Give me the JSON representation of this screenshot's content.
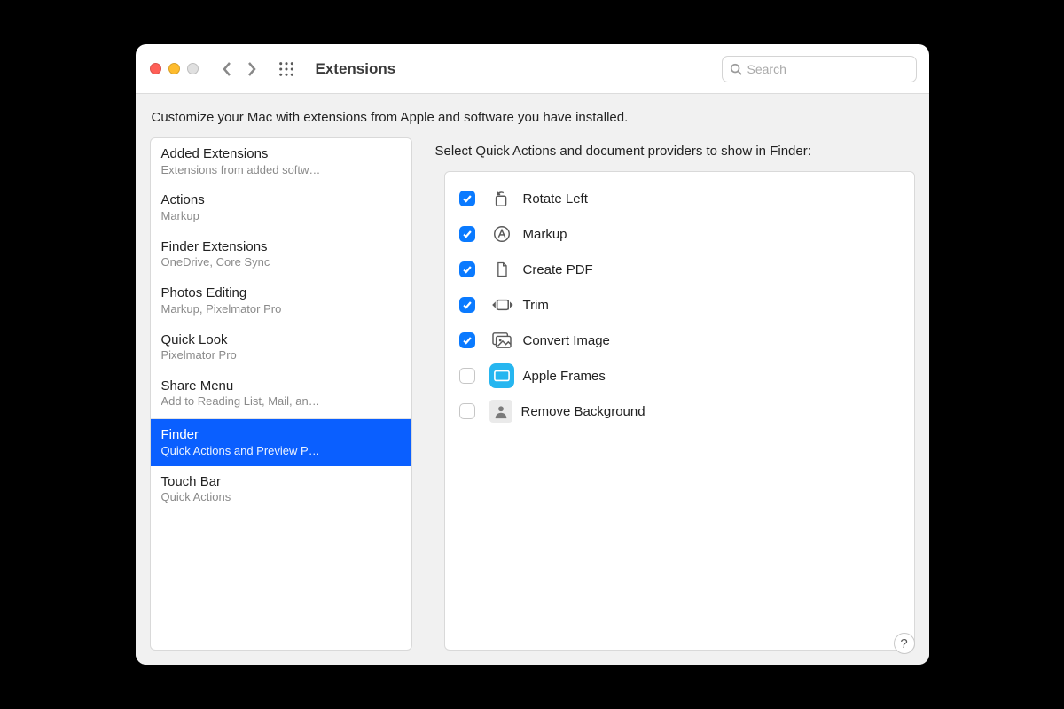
{
  "window": {
    "title": "Extensions",
    "search_placeholder": "Search"
  },
  "intro": "Customize your Mac with extensions from Apple and software you have installed.",
  "sidebar": {
    "items": [
      {
        "title": "Added Extensions",
        "sub": "Extensions from added softw…",
        "selected": false
      },
      {
        "title": "Actions",
        "sub": "Markup",
        "selected": false
      },
      {
        "title": "Finder Extensions",
        "sub": "OneDrive, Core Sync",
        "selected": false
      },
      {
        "title": "Photos Editing",
        "sub": "Markup, Pixelmator Pro",
        "selected": false
      },
      {
        "title": "Quick Look",
        "sub": "Pixelmator Pro",
        "selected": false
      },
      {
        "title": "Share Menu",
        "sub": "Add to Reading List, Mail, an…",
        "selected": false
      },
      {
        "title": "Finder",
        "sub": "Quick Actions and Preview P…",
        "selected": true
      },
      {
        "title": "Touch Bar",
        "sub": "Quick Actions",
        "selected": false
      }
    ]
  },
  "detail": {
    "heading": "Select Quick Actions and document providers to show in Finder:",
    "rows": [
      {
        "label": "Rotate Left",
        "checked": true,
        "icon": "rotate-left-icon"
      },
      {
        "label": "Markup",
        "checked": true,
        "icon": "markup-icon"
      },
      {
        "label": "Create PDF",
        "checked": true,
        "icon": "document-icon"
      },
      {
        "label": "Trim",
        "checked": true,
        "icon": "trim-icon"
      },
      {
        "label": "Convert Image",
        "checked": true,
        "icon": "photo-stack-icon"
      },
      {
        "label": "Apple Frames",
        "checked": false,
        "icon": "apple-frames-icon"
      },
      {
        "label": "Remove Background",
        "checked": false,
        "icon": "person-crop-icon"
      }
    ]
  },
  "help_label": "?"
}
